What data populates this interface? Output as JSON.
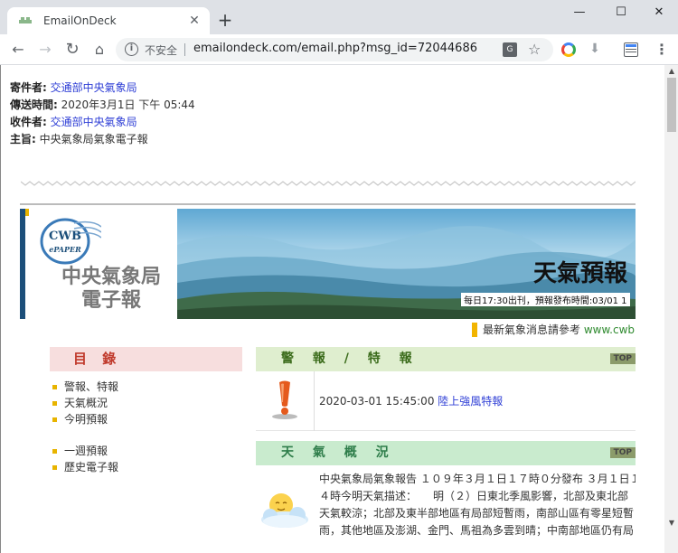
{
  "browser": {
    "tab_title": "EmailOnDeck",
    "tab_close": "✕",
    "new_tab": "+",
    "security_label": "不安全",
    "url": "emailondeck.com/email.php?msg_id=72044686"
  },
  "email": {
    "from_label": "寄件者:",
    "from_value": "交通部中央氣象局",
    "sent_label": "傳送時間:",
    "sent_value": "2020年3月1日 下午 05:44",
    "to_label": "收件者:",
    "to_value": "交通部中央氣象局",
    "subject_label": "主旨:",
    "subject_value": "中央氣象局氣象電子報"
  },
  "newsletter": {
    "logo_top": "CWB",
    "logo_bottom": "ePAPER",
    "name_line1": "中央氣象局",
    "name_line2": "電子報",
    "banner_title": "天氣預報",
    "banner_caption": "每日17:30出刊，預報發布時間:03/01 1",
    "notice_text": "最新氣象消息請參考 ",
    "notice_link": "www.cwb.g",
    "toc": {
      "title": "目 錄",
      "items": [
        "警報、特報",
        "天氣概況",
        "今明預報",
        "一週預報",
        "歷史電子報"
      ]
    },
    "warning": {
      "title": "警 報 / 特 報",
      "top_label": "TOP",
      "datetime": "2020-03-01 15:45:00 ",
      "link": "陸上強風特報"
    },
    "overview": {
      "title": "天 氣 概 況",
      "top_label": "TOP",
      "line1": "中央氣象局氣象報告 １０９年３月１日１７時０分發布 ３月１日１",
      "line2": "４時今明天氣描述：　　明（２）日東北季風影響，北部及東北部",
      "line3": "天氣較涼；北部及東半部地區有局部短暫雨，南部山區有零星短暫",
      "line4": "雨，其他地區及澎湖、金門、馬祖為多雲到晴；中南部地區仍有局"
    }
  },
  "colors": {
    "link_blue": "#2f3fd6",
    "toc_title": "#c0392b",
    "warning_head_bg": "#dfeecf",
    "overview_head_bg": "#c9ebce"
  }
}
